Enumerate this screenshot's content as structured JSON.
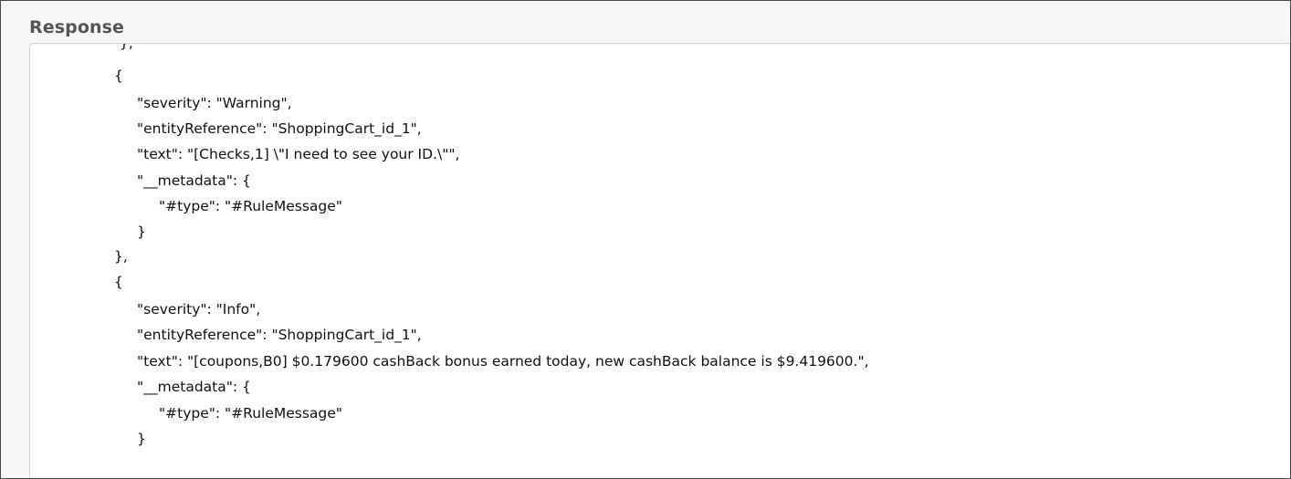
{
  "panel": {
    "title": "Response"
  },
  "response": {
    "lines": [
      "},",
      "{",
      "\"severity\": \"Warning\",",
      "\"entityReference\": \"ShoppingCart_id_1\",",
      "\"text\": \"[Checks,1] \\\"I need to see your ID.\\\"\",",
      "\"__metadata\": {",
      "\"#type\": \"#RuleMessage\"",
      "}",
      "},",
      "{",
      "\"severity\": \"Info\",",
      "\"entityReference\": \"ShoppingCart_id_1\",",
      "\"text\": \"[coupons,B0] $0.179600 cashBack bonus earned today, new cashBack balance is $9.419600.\",",
      "\"__metadata\": {",
      "\"#type\": \"#RuleMessage\"",
      "}"
    ]
  },
  "colors": {
    "border": "#4a4a4a",
    "panel_background": "#f7f7f7",
    "title_text": "#555555",
    "box_border": "#cfd8e2",
    "code_text": "#111111"
  }
}
